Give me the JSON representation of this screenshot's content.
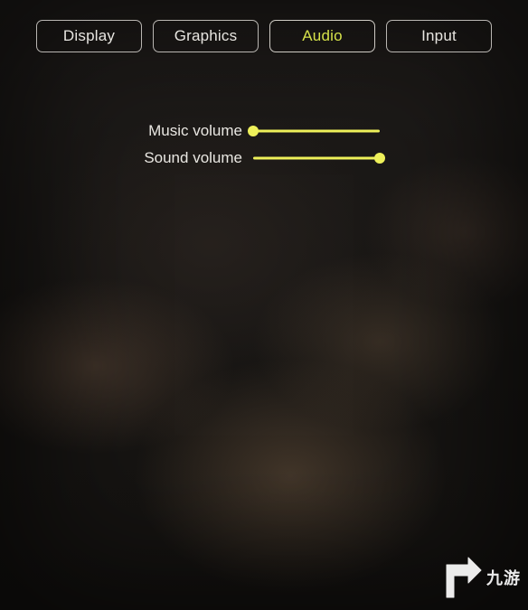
{
  "colors": {
    "accent": "#eef05a",
    "text": "#e8e6e1"
  },
  "tabs": [
    {
      "id": "display",
      "label": "Display",
      "active": false
    },
    {
      "id": "graphics",
      "label": "Graphics",
      "active": false
    },
    {
      "id": "audio",
      "label": "Audio",
      "active": true
    },
    {
      "id": "input",
      "label": "Input",
      "active": false
    }
  ],
  "audio": {
    "music": {
      "label": "Music volume",
      "value": 0,
      "max": 100
    },
    "sound": {
      "label": "Sound volume",
      "value": 100,
      "max": 100
    }
  },
  "watermark": {
    "text": "九游"
  }
}
